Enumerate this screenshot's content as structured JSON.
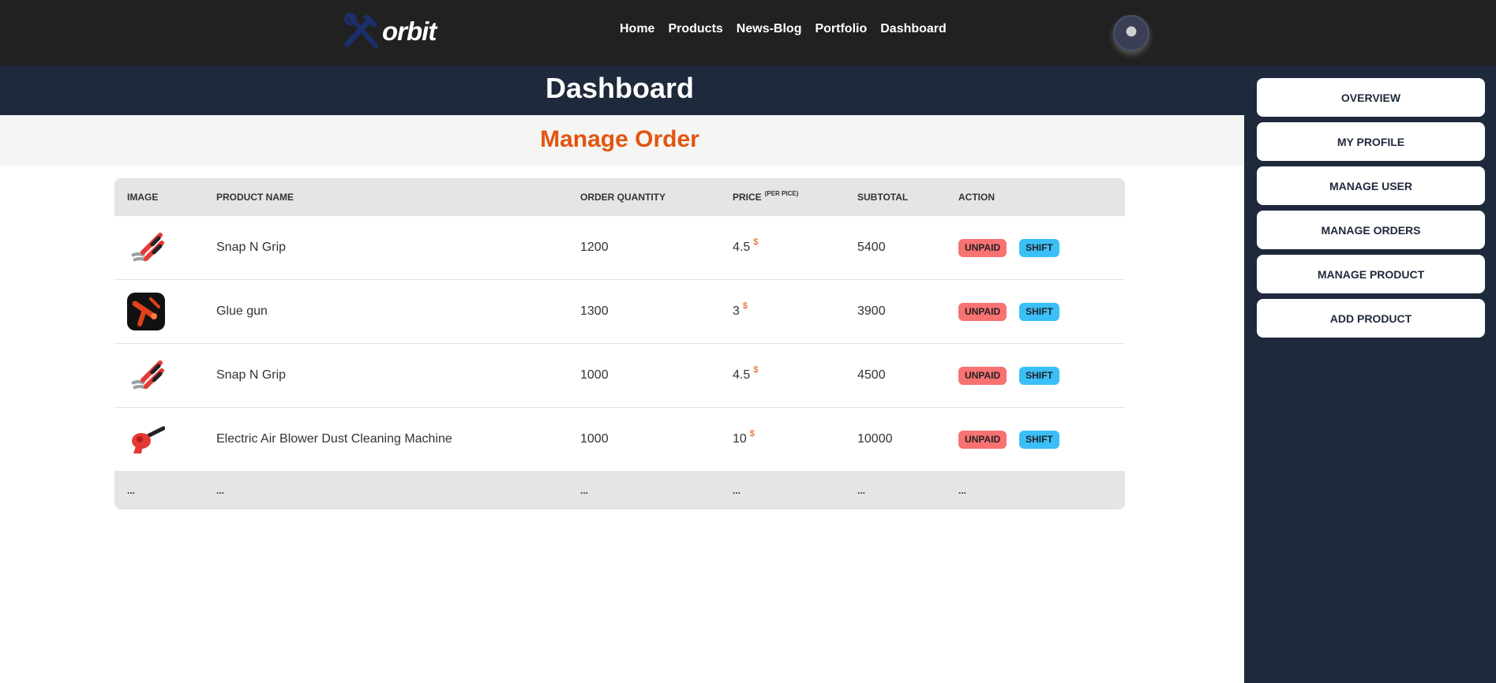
{
  "brand": {
    "name": "orbit"
  },
  "nav": {
    "items": [
      "Home",
      "Products",
      "News-Blog",
      "Portfolio",
      "Dashboard"
    ]
  },
  "hero": {
    "title": "Dashboard"
  },
  "section": {
    "title": "Manage Order"
  },
  "table": {
    "headers": {
      "image": "IMAGE",
      "name": "PRODUCT NAME",
      "qty": "ORDER QUANTITY",
      "price": "PRICE",
      "price_note": "(PER PICE)",
      "subtotal": "SUBTOTAL",
      "action": "ACTION"
    },
    "rows": [
      {
        "image": "pliers-image",
        "name": "Snap N Grip",
        "qty": "1200",
        "price": "4.5",
        "currency": "$",
        "subtotal": "5400",
        "status": "UNPAID",
        "shift": "SHIFT"
      },
      {
        "image": "glue-gun-image",
        "name": "Glue gun",
        "qty": "1300",
        "price": "3",
        "currency": "$",
        "subtotal": "3900",
        "status": "UNPAID",
        "shift": "SHIFT"
      },
      {
        "image": "pliers-image",
        "name": "Snap N Grip",
        "qty": "1000",
        "price": "4.5",
        "currency": "$",
        "subtotal": "4500",
        "status": "UNPAID",
        "shift": "SHIFT"
      },
      {
        "image": "air-blower-image",
        "name": "Electric Air Blower Dust Cleaning Machine",
        "qty": "1000",
        "price": "10",
        "currency": "$",
        "subtotal": "10000",
        "status": "UNPAID",
        "shift": "SHIFT"
      }
    ],
    "footer": [
      "...",
      "...",
      "...",
      "...",
      "...",
      "..."
    ]
  },
  "sidebar": {
    "items": [
      "OVERVIEW",
      "MY PROFILE",
      "MANAGE USER",
      "MANAGE ORDERS",
      "MANAGE PRODUCT",
      "ADD PRODUCT"
    ]
  },
  "colors": {
    "topbar": "#212121",
    "navy": "#1e293b",
    "accent": "#e4540f",
    "unpaid": "#f87272",
    "shift": "#3abff8"
  }
}
